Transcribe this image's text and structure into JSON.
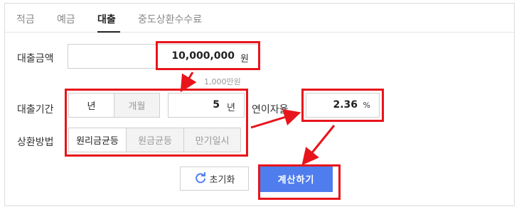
{
  "tabs": [
    {
      "label": "적금",
      "active": false
    },
    {
      "label": "예금",
      "active": false
    },
    {
      "label": "대출",
      "active": true
    },
    {
      "label": "중도상환수수료",
      "active": false
    }
  ],
  "loan_amount": {
    "label": "대출금액",
    "value": "10,000,000",
    "unit": "원",
    "hint": "1,000만원"
  },
  "loan_period": {
    "label": "대출기간",
    "unit_options": [
      "년",
      "개월"
    ],
    "selected_unit": "년",
    "value": "5",
    "unit": "년"
  },
  "interest": {
    "label": "연이자율",
    "value": "2.36",
    "unit": "%"
  },
  "repayment": {
    "label": "상환방법",
    "options": [
      "원리금균등",
      "원금균등",
      "만기일시"
    ],
    "selected": "원리금균등"
  },
  "buttons": {
    "reset": "초기화",
    "calculate": "계산하기"
  },
  "colors": {
    "accent": "#4f7ded",
    "highlight": "#e8141b"
  }
}
